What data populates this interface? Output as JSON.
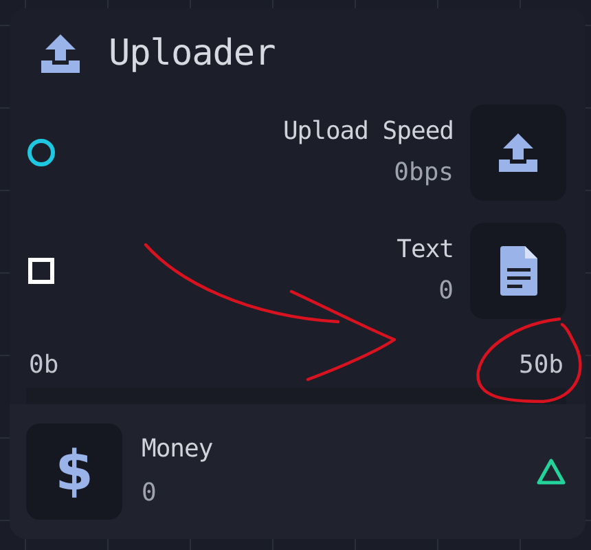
{
  "node": {
    "title": "Uploader",
    "rows": [
      {
        "label": "Upload Speed",
        "value": "0bps",
        "port": {
          "kind": "circle",
          "color": "#1ec8e0"
        }
      },
      {
        "label": "Text",
        "value": "0",
        "port": {
          "kind": "square",
          "color": "#ffffff"
        }
      }
    ],
    "range": {
      "min": "0b",
      "max": "50b"
    },
    "output": {
      "icon": "$",
      "label": "Money",
      "value": "0",
      "port": {
        "kind": "triangle",
        "color": "#22d39a"
      }
    }
  }
}
